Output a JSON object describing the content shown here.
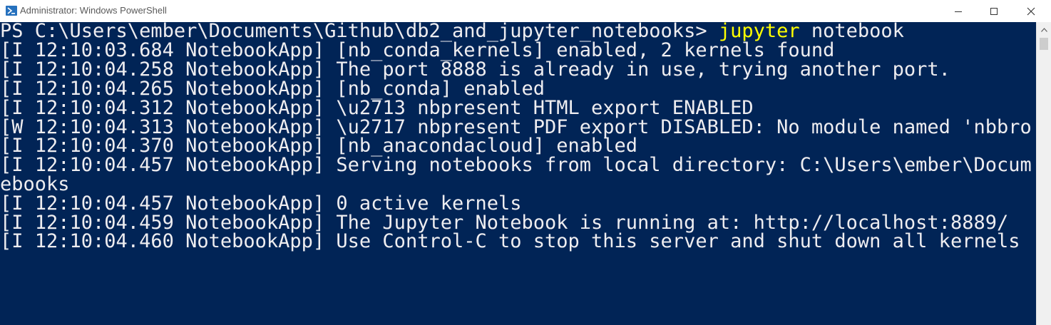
{
  "window": {
    "title": "Administrator: Windows PowerShell",
    "icon": "powershell-icon",
    "controls": [
      "minimize-icon",
      "maximize-icon",
      "close-icon"
    ]
  },
  "colors": {
    "console_bg": "#012456",
    "console_fg": "#eeedf0",
    "command_highlight": "#ffff00"
  },
  "console": {
    "prompt": "PS C:\\Users\\ember\\Documents\\Github\\db2_and_jupyter_notebooks> ",
    "command_exe": "jupyter",
    "command_args": " notebook",
    "lines": [
      "[I 12:10:03.684 NotebookApp] [nb_conda_kernels] enabled, 2 kernels found",
      "[I 12:10:04.258 NotebookApp] The port 8888 is already in use, trying another port.",
      "[I 12:10:04.265 NotebookApp] [nb_conda] enabled",
      "[I 12:10:04.312 NotebookApp] \\u2713 nbpresent HTML export ENABLED",
      "[W 12:10:04.313 NotebookApp] \\u2717 nbpresent PDF export DISABLED: No module named 'nbbro",
      "[I 12:10:04.370 NotebookApp] [nb_anacondacloud] enabled",
      "[I 12:10:04.457 NotebookApp] Serving notebooks from local directory: C:\\Users\\ember\\Docum",
      "ebooks",
      "[I 12:10:04.457 NotebookApp] 0 active kernels",
      "[I 12:10:04.459 NotebookApp] The Jupyter Notebook is running at: http://localhost:8889/",
      "[I 12:10:04.460 NotebookApp] Use Control-C to stop this server and shut down all kernels"
    ]
  }
}
